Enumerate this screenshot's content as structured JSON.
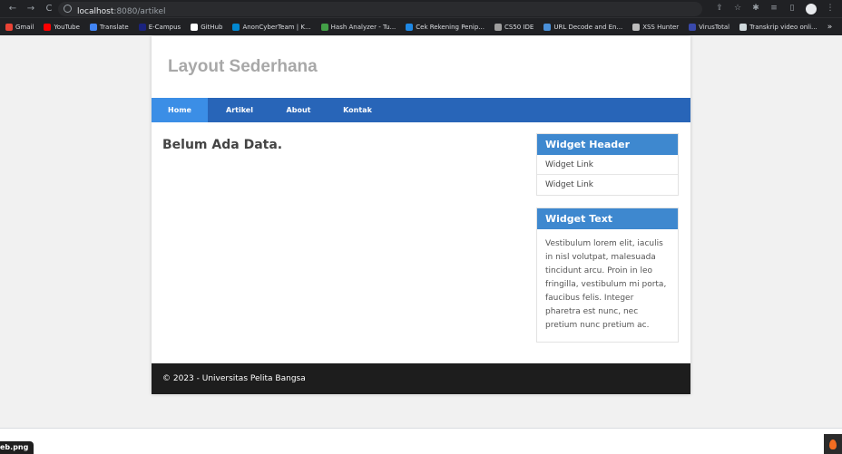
{
  "browser": {
    "url_host": "localhost",
    "url_path": ":8080/artikel",
    "bookmarks": [
      {
        "label": "Gmail",
        "color": "#ea4335"
      },
      {
        "label": "YouTube",
        "color": "#ff0000"
      },
      {
        "label": "Translate",
        "color": "#4285f4"
      },
      {
        "label": "E-Campus",
        "color": "#1a237e"
      },
      {
        "label": "GitHub",
        "color": "#ffffff"
      },
      {
        "label": "AnonCyberTeam | K...",
        "color": "#0288d1"
      },
      {
        "label": "Hash Analyzer - Tu...",
        "color": "#43a047"
      },
      {
        "label": "Cek Rekening Penip...",
        "color": "#1e88e5"
      },
      {
        "label": "CS50 IDE",
        "color": "#9e9e9e"
      },
      {
        "label": "URL Decode and En...",
        "color": "#4a90d9"
      },
      {
        "label": "XSS Hunter",
        "color": "#bdbdbd"
      },
      {
        "label": "VirusTotal",
        "color": "#3949ab"
      },
      {
        "label": "Transkrip video onli...",
        "color": "#cfd8dc"
      }
    ],
    "bookmarks_more": "»"
  },
  "site": {
    "title": "Layout Sederhana",
    "nav": [
      "Home",
      "Artikel",
      "About",
      "Kontak"
    ],
    "content_text": "Belum Ada Data.",
    "widget1": {
      "header": "Widget Header",
      "links": [
        "Widget Link",
        "Widget Link"
      ]
    },
    "widget2": {
      "header": "Widget Text",
      "body": "Vestibulum lorem elit, iaculis in nisl volutpat, malesuada tincidunt arcu. Proin in leo fringilla, vestibulum mi porta, faucibus felis. Integer pharetra est nunc, nec pretium nunc pretium ac."
    },
    "footer": "© 2023 - Universitas Pelita Bangsa"
  },
  "download": {
    "filename": "eb.png"
  }
}
